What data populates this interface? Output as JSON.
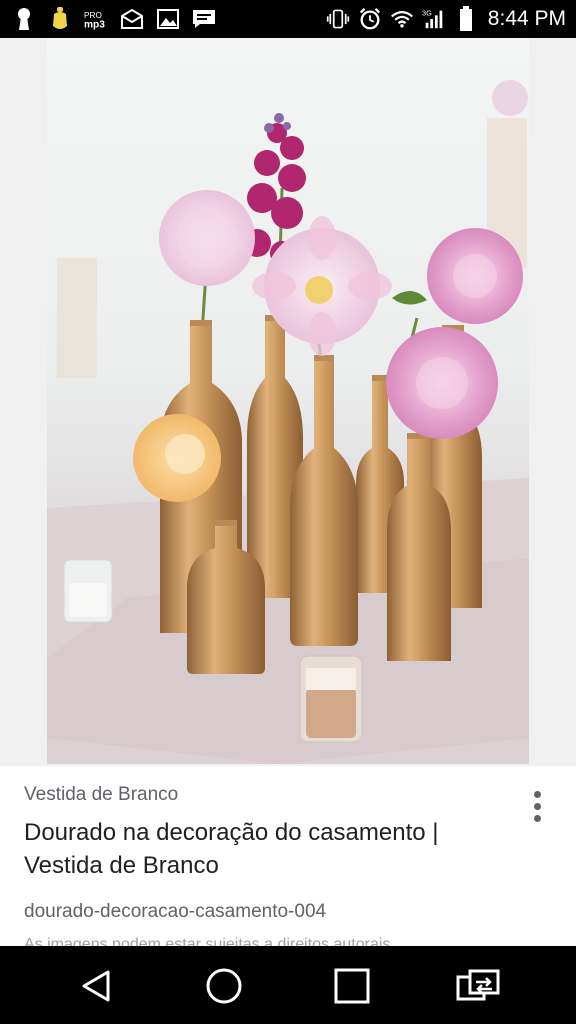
{
  "status_bar": {
    "time": "8:44 PM",
    "left_icons": [
      "keyhole-icon",
      "pacifier-icon",
      "mp3-icon",
      "inbox-icon",
      "image-icon",
      "message-icon"
    ],
    "right_icons": [
      "vibrate-icon",
      "alarm-icon",
      "wifi-icon",
      "signal-icon",
      "battery-icon"
    ]
  },
  "result": {
    "source": "Vestida de Branco",
    "title": "Dourado na decoração do casamento | Vestida de Branco",
    "filename": "dourado-decoracao-casamento-004",
    "disclaimer": "As imagens podem estar sujeitas a direitos autorais."
  },
  "nav_bar": {
    "buttons": [
      "back-icon",
      "home-icon",
      "recents-icon",
      "switch-icon"
    ]
  },
  "colors": {
    "gold": "#c9975c",
    "pink": "#e7a8d2",
    "magenta": "#b0266f",
    "peach": "#f2b96a"
  }
}
